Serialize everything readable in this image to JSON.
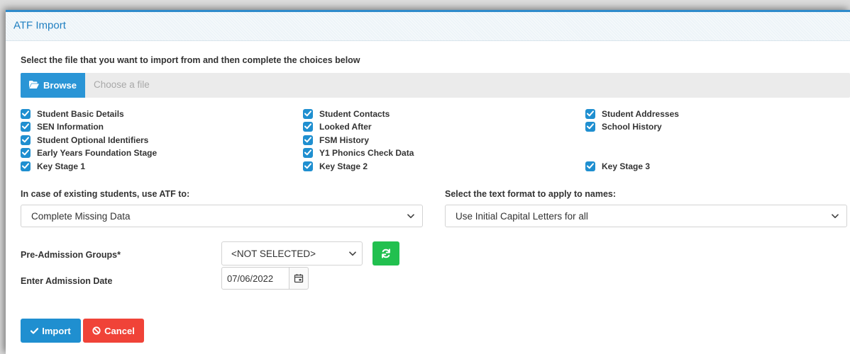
{
  "panel": {
    "title": "ATF Import"
  },
  "intro_text": "Select the file that you want to import from and then complete the choices below",
  "file": {
    "browse_label": "Browse",
    "placeholder": "Choose a file"
  },
  "checkboxes": [
    {
      "label": "Student Basic Details",
      "checked": true
    },
    {
      "label": "Student Contacts",
      "checked": true
    },
    {
      "label": "Student Addresses",
      "checked": true
    },
    {
      "label": "SEN Information",
      "checked": true
    },
    {
      "label": "Looked After",
      "checked": true
    },
    {
      "label": "School History",
      "checked": true
    },
    {
      "label": "Student Optional Identifiers",
      "checked": true
    },
    {
      "label": "FSM History",
      "checked": true
    },
    {
      "label": "Early Years Foundation Stage",
      "checked": true
    },
    {
      "label": "Y1 Phonics Check Data",
      "checked": true
    },
    {
      "label": "Key Stage 1",
      "checked": true
    },
    {
      "label": "Key Stage 2",
      "checked": true
    },
    {
      "label": "Key Stage 3",
      "checked": true
    }
  ],
  "existing": {
    "label": "In case of existing students, use ATF to:",
    "selected": "Complete Missing Data"
  },
  "format": {
    "label": "Select the text format to apply to names:",
    "selected": "Use Initial Capital Letters for all"
  },
  "groups": {
    "label": "Pre-Admission Groups*",
    "selected": "<NOT SELECTED>"
  },
  "admission": {
    "label": "Enter Admission Date",
    "value": "07/06/2022"
  },
  "actions": {
    "import_label": "Import",
    "cancel_label": "Cancel"
  },
  "colors": {
    "accent": "#2e8bcb",
    "primary_button": "#1f8fd0",
    "cancel_button": "#f04338",
    "refresh_button": "#22c04f",
    "checkbox": "#1f8fd0"
  }
}
